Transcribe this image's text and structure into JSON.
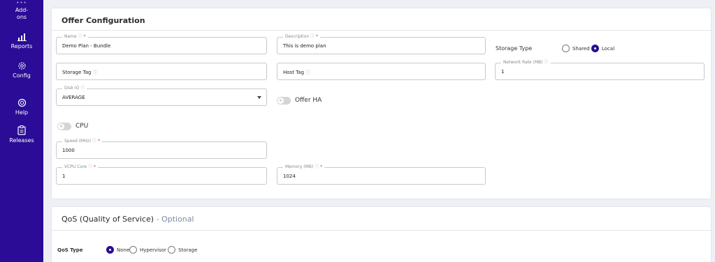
{
  "sidebar": {
    "addons_label": "Add-\nons",
    "items": [
      {
        "label": "Reports",
        "icon": "bar-chart-icon"
      },
      {
        "label": "Config",
        "icon": "gear-icon"
      },
      {
        "label": "Help",
        "icon": "lifebuoy-icon"
      },
      {
        "label": "Releases",
        "icon": "clipboard-icon"
      }
    ],
    "bg_color": "#2a0c96"
  },
  "offer_config": {
    "title": "Offer Configuration",
    "name": {
      "label": "Name",
      "value": "Demo Plan - Bundle"
    },
    "description": {
      "label": "Description",
      "value": "This is demo plan"
    },
    "storage_type": {
      "label": "Storage Type",
      "options": [
        "Shared",
        "Local"
      ],
      "selected": "Local"
    },
    "storage_tag": {
      "placeholder": "Storage Tag"
    },
    "host_tag": {
      "placeholder": "Host Tag"
    },
    "network_rate": {
      "label": "Network Rate (MB)",
      "value": "1"
    },
    "disk_io": {
      "label": "Disk IO",
      "value": "AVERAGE"
    },
    "offer_ha": {
      "label": "Offer HA",
      "enabled": false
    },
    "cpu": {
      "label": "CPU",
      "enabled": false
    },
    "speed": {
      "label": "Speed (MHz)",
      "value": "1000"
    },
    "vcpu": {
      "label": "VCPU Core",
      "value": "1"
    },
    "memory": {
      "label": "Memory (MB)",
      "value": "1024"
    }
  },
  "qos": {
    "title": "QoS (Quality of Service)",
    "title_suffix": " - Optional",
    "type_label": "QoS Type",
    "options": [
      "None",
      "Hypervisor",
      "Storage"
    ],
    "selected": "None"
  }
}
